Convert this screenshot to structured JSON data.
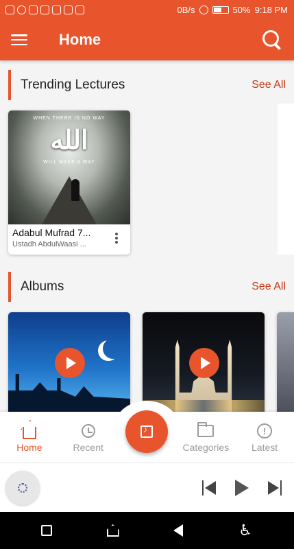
{
  "status_bar": {
    "network_speed": "0B/s",
    "battery": "50%",
    "time": "9:18 PM"
  },
  "app_bar": {
    "title": "Home"
  },
  "sections": {
    "trending": {
      "title": "Trending Lectures",
      "see_all": "See All",
      "card": {
        "title": "Adabul Mufrad 7...",
        "subtitle": "Ustadh AbdulWaasi ...",
        "thumb_top": "WHEN THERE IS NO WAY",
        "thumb_arabic": "الله",
        "thumb_bottom": "WILL MAKE A WAY"
      }
    },
    "albums": {
      "title": "Albums",
      "see_all": "See All"
    }
  },
  "bottom_nav": {
    "items": [
      {
        "label": "Home",
        "icon": "home-icon",
        "active": true
      },
      {
        "label": "Recent",
        "icon": "history-icon",
        "active": false
      },
      {
        "label": "",
        "icon": "music-library-icon",
        "active": false
      },
      {
        "label": "Categories",
        "icon": "folder-icon",
        "active": false
      },
      {
        "label": "Latest",
        "icon": "alert-icon",
        "active": false
      }
    ]
  },
  "colors": {
    "accent": "#e8552d",
    "see_all": "#c63a17"
  }
}
